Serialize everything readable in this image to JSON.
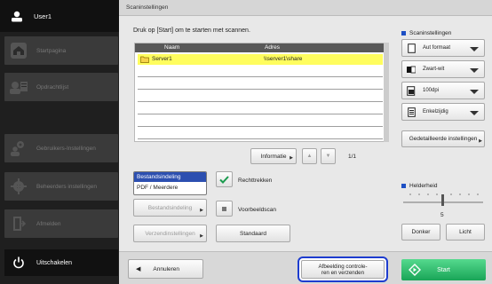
{
  "sidebar": {
    "user": "User1",
    "items": [
      {
        "label": "Startpagina",
        "icon": "home-icon"
      },
      {
        "label": "Opdrachtlijst",
        "icon": "job-list-icon"
      },
      {
        "label": "Gebruikers-Instellingen",
        "icon": "user-settings-icon"
      },
      {
        "label": "Beheerders instellingen",
        "icon": "admin-settings-icon"
      },
      {
        "label": "Afmelden",
        "icon": "logout-icon"
      }
    ],
    "power_label": "Uitschakelen"
  },
  "header": {
    "title": "Scaninstellingen"
  },
  "main": {
    "instruction": "Druk op [Start] om te starten met scannen.",
    "table": {
      "columns": [
        "Naam",
        "Adres"
      ],
      "rows": [
        {
          "name": "Server1",
          "address": "\\\\server1\\share",
          "selected": true
        }
      ]
    },
    "info_button": "Informatie",
    "page_indicator": "1/1",
    "file_format": {
      "label": "Bestandsindeling",
      "value": "PDF / Meerdere"
    },
    "buttons": {
      "file_format": "Bestandsindeling",
      "send_settings": "Verzendinstellingen",
      "straighten": "Rechttrekken",
      "preview": "Voorbeeldscan",
      "default": "Standaard"
    }
  },
  "settings": {
    "title": "Scaninstellingen",
    "options": [
      {
        "value": "Aut formaat",
        "icon": "page-size-icon"
      },
      {
        "value": "Zwart-wit",
        "icon": "color-mode-icon"
      },
      {
        "value": "100dpi",
        "icon": "resolution-icon"
      },
      {
        "value": "Enkelzijdig",
        "icon": "simplex-icon"
      }
    ],
    "detailed_button": "Gedetailleerde instellingen",
    "brightness": {
      "title": "Helderheid",
      "value": "5",
      "level": 5,
      "max": 9,
      "dark": "Donker",
      "light": "Licht"
    }
  },
  "bottom": {
    "cancel": "Annuleren",
    "verify_send": "Afbeelding controle-\nren en verzenden",
    "start": "Start"
  },
  "colors": {
    "accent": "#1d4fc4",
    "start": "#19a557",
    "selection": "#fffd5e"
  }
}
